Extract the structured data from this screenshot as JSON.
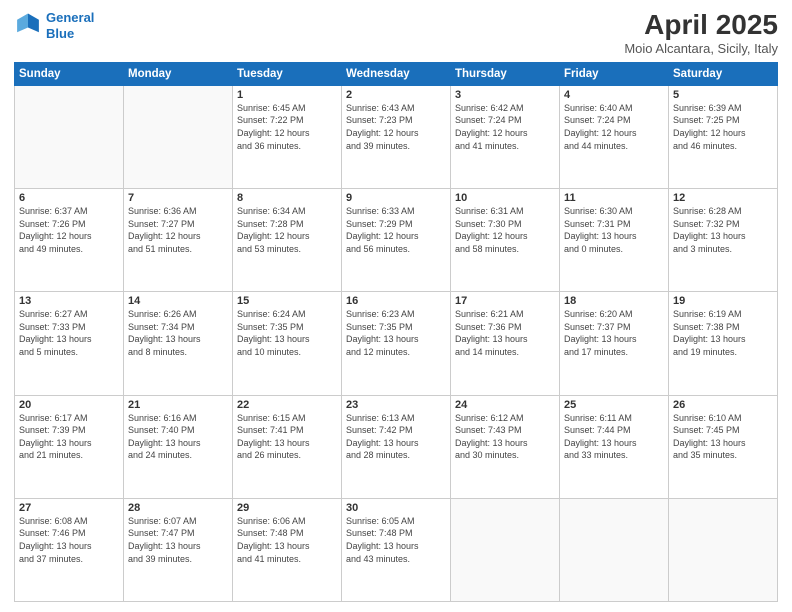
{
  "header": {
    "logo_line1": "General",
    "logo_line2": "Blue",
    "month": "April 2025",
    "location": "Moio Alcantara, Sicily, Italy"
  },
  "weekdays": [
    "Sunday",
    "Monday",
    "Tuesday",
    "Wednesday",
    "Thursday",
    "Friday",
    "Saturday"
  ],
  "weeks": [
    [
      {
        "day": "",
        "info": ""
      },
      {
        "day": "",
        "info": ""
      },
      {
        "day": "1",
        "info": "Sunrise: 6:45 AM\nSunset: 7:22 PM\nDaylight: 12 hours\nand 36 minutes."
      },
      {
        "day": "2",
        "info": "Sunrise: 6:43 AM\nSunset: 7:23 PM\nDaylight: 12 hours\nand 39 minutes."
      },
      {
        "day": "3",
        "info": "Sunrise: 6:42 AM\nSunset: 7:24 PM\nDaylight: 12 hours\nand 41 minutes."
      },
      {
        "day": "4",
        "info": "Sunrise: 6:40 AM\nSunset: 7:24 PM\nDaylight: 12 hours\nand 44 minutes."
      },
      {
        "day": "5",
        "info": "Sunrise: 6:39 AM\nSunset: 7:25 PM\nDaylight: 12 hours\nand 46 minutes."
      }
    ],
    [
      {
        "day": "6",
        "info": "Sunrise: 6:37 AM\nSunset: 7:26 PM\nDaylight: 12 hours\nand 49 minutes."
      },
      {
        "day": "7",
        "info": "Sunrise: 6:36 AM\nSunset: 7:27 PM\nDaylight: 12 hours\nand 51 minutes."
      },
      {
        "day": "8",
        "info": "Sunrise: 6:34 AM\nSunset: 7:28 PM\nDaylight: 12 hours\nand 53 minutes."
      },
      {
        "day": "9",
        "info": "Sunrise: 6:33 AM\nSunset: 7:29 PM\nDaylight: 12 hours\nand 56 minutes."
      },
      {
        "day": "10",
        "info": "Sunrise: 6:31 AM\nSunset: 7:30 PM\nDaylight: 12 hours\nand 58 minutes."
      },
      {
        "day": "11",
        "info": "Sunrise: 6:30 AM\nSunset: 7:31 PM\nDaylight: 13 hours\nand 0 minutes."
      },
      {
        "day": "12",
        "info": "Sunrise: 6:28 AM\nSunset: 7:32 PM\nDaylight: 13 hours\nand 3 minutes."
      }
    ],
    [
      {
        "day": "13",
        "info": "Sunrise: 6:27 AM\nSunset: 7:33 PM\nDaylight: 13 hours\nand 5 minutes."
      },
      {
        "day": "14",
        "info": "Sunrise: 6:26 AM\nSunset: 7:34 PM\nDaylight: 13 hours\nand 8 minutes."
      },
      {
        "day": "15",
        "info": "Sunrise: 6:24 AM\nSunset: 7:35 PM\nDaylight: 13 hours\nand 10 minutes."
      },
      {
        "day": "16",
        "info": "Sunrise: 6:23 AM\nSunset: 7:35 PM\nDaylight: 13 hours\nand 12 minutes."
      },
      {
        "day": "17",
        "info": "Sunrise: 6:21 AM\nSunset: 7:36 PM\nDaylight: 13 hours\nand 14 minutes."
      },
      {
        "day": "18",
        "info": "Sunrise: 6:20 AM\nSunset: 7:37 PM\nDaylight: 13 hours\nand 17 minutes."
      },
      {
        "day": "19",
        "info": "Sunrise: 6:19 AM\nSunset: 7:38 PM\nDaylight: 13 hours\nand 19 minutes."
      }
    ],
    [
      {
        "day": "20",
        "info": "Sunrise: 6:17 AM\nSunset: 7:39 PM\nDaylight: 13 hours\nand 21 minutes."
      },
      {
        "day": "21",
        "info": "Sunrise: 6:16 AM\nSunset: 7:40 PM\nDaylight: 13 hours\nand 24 minutes."
      },
      {
        "day": "22",
        "info": "Sunrise: 6:15 AM\nSunset: 7:41 PM\nDaylight: 13 hours\nand 26 minutes."
      },
      {
        "day": "23",
        "info": "Sunrise: 6:13 AM\nSunset: 7:42 PM\nDaylight: 13 hours\nand 28 minutes."
      },
      {
        "day": "24",
        "info": "Sunrise: 6:12 AM\nSunset: 7:43 PM\nDaylight: 13 hours\nand 30 minutes."
      },
      {
        "day": "25",
        "info": "Sunrise: 6:11 AM\nSunset: 7:44 PM\nDaylight: 13 hours\nand 33 minutes."
      },
      {
        "day": "26",
        "info": "Sunrise: 6:10 AM\nSunset: 7:45 PM\nDaylight: 13 hours\nand 35 minutes."
      }
    ],
    [
      {
        "day": "27",
        "info": "Sunrise: 6:08 AM\nSunset: 7:46 PM\nDaylight: 13 hours\nand 37 minutes."
      },
      {
        "day": "28",
        "info": "Sunrise: 6:07 AM\nSunset: 7:47 PM\nDaylight: 13 hours\nand 39 minutes."
      },
      {
        "day": "29",
        "info": "Sunrise: 6:06 AM\nSunset: 7:48 PM\nDaylight: 13 hours\nand 41 minutes."
      },
      {
        "day": "30",
        "info": "Sunrise: 6:05 AM\nSunset: 7:48 PM\nDaylight: 13 hours\nand 43 minutes."
      },
      {
        "day": "",
        "info": ""
      },
      {
        "day": "",
        "info": ""
      },
      {
        "day": "",
        "info": ""
      }
    ]
  ]
}
